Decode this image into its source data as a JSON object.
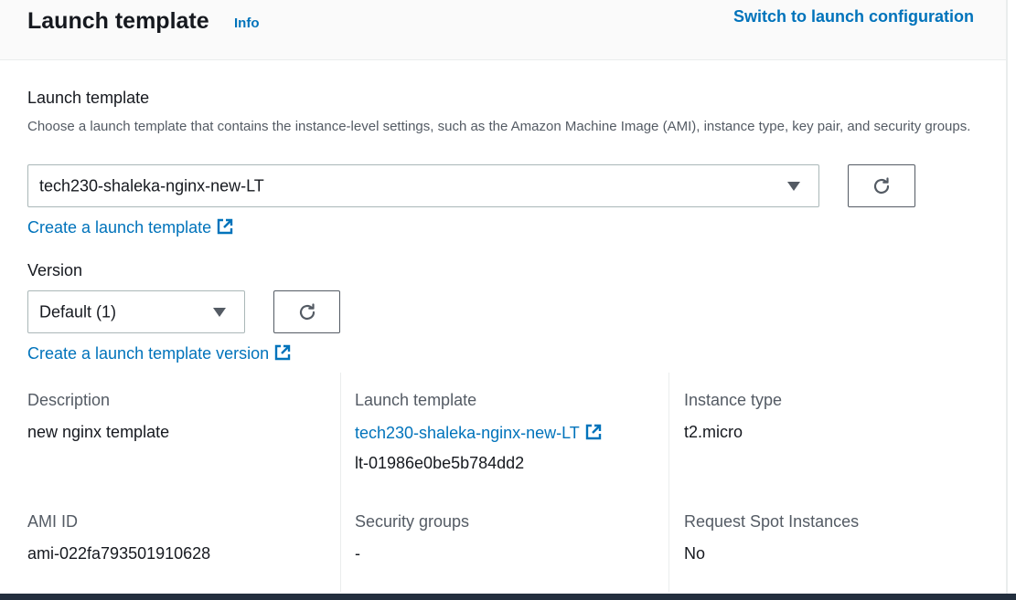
{
  "header": {
    "title": "Launch template",
    "info_label": "Info",
    "switch_label": "Switch to launch configuration"
  },
  "launch_template_field": {
    "label": "Launch template",
    "description": "Choose a launch template that contains the instance-level settings, such as the Amazon Machine Image (AMI), instance type, key pair, and security groups.",
    "selected_value": "tech230-shaleka-nginx-new-LT",
    "create_link": "Create a launch template"
  },
  "version_field": {
    "label": "Version",
    "selected_value": "Default (1)",
    "create_link": "Create a launch template version"
  },
  "details": {
    "description": {
      "label": "Description",
      "value": "new nginx template"
    },
    "launch_template": {
      "label": "Launch template",
      "name": "tech230-shaleka-nginx-new-LT",
      "id": "lt-01986e0be5b784dd2"
    },
    "instance_type": {
      "label": "Instance type",
      "value": "t2.micro"
    },
    "ami_id": {
      "label": "AMI ID",
      "value": "ami-022fa793501910628"
    },
    "security_groups": {
      "label": "Security groups",
      "value": "-"
    },
    "request_spot": {
      "label": "Request Spot Instances",
      "value": "No"
    }
  },
  "icons": {
    "refresh": "refresh-icon",
    "external": "external-link-icon",
    "caret": "caret-down-icon"
  },
  "colors": {
    "link": "#0073bb",
    "text": "#16191f",
    "secondary_text": "#545b64",
    "header_bg": "#fafafa",
    "bottom_bar": "#232f3e"
  }
}
